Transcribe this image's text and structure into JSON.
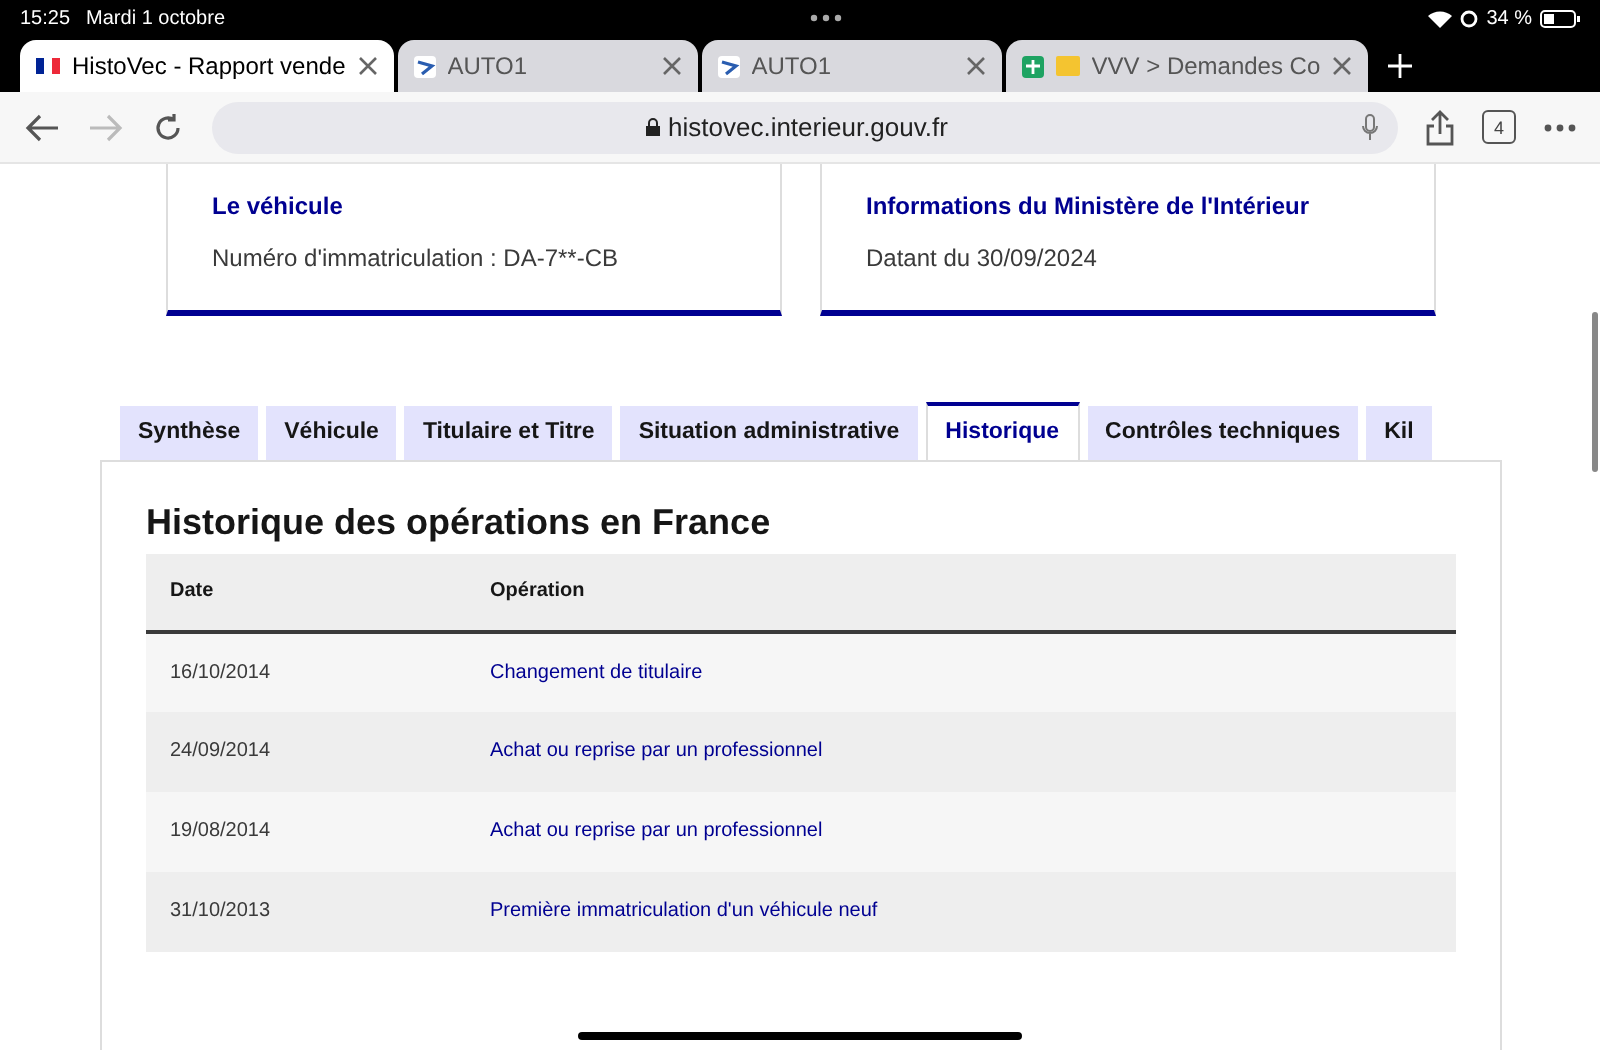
{
  "status_bar": {
    "time": "15:25",
    "date": "Mardi 1 octobre",
    "battery": "34 %"
  },
  "browser_tabs": [
    {
      "title": "HistoVec - Rapport vende",
      "kind": "flag",
      "selected": true
    },
    {
      "title": "AUTO1",
      "kind": "arrow",
      "selected": false
    },
    {
      "title": "AUTO1",
      "kind": "arrow",
      "selected": false
    },
    {
      "title": "VVV > Demandes Co",
      "kind": "sheet",
      "selected": false
    }
  ],
  "address_bar": {
    "url": "histovec.interieur.gouv.fr",
    "tab_count": "4"
  },
  "cards": [
    {
      "title": "Le véhicule",
      "text": "Numéro d'immatriculation : DA-7**-CB"
    },
    {
      "title": "Informations du Ministère de l'Intérieur",
      "text": "Datant du 30/09/2024"
    }
  ],
  "page_tabs": [
    {
      "label": "Synthèse",
      "selected": false
    },
    {
      "label": "Véhicule",
      "selected": false
    },
    {
      "label": "Titulaire et Titre",
      "selected": false
    },
    {
      "label": "Situation administrative",
      "selected": false
    },
    {
      "label": "Historique",
      "selected": true
    },
    {
      "label": "Contrôles techniques",
      "selected": false
    },
    {
      "label": "Kil",
      "selected": false
    }
  ],
  "section_title": "Historique des opérations en France",
  "table": {
    "columns": [
      "Date",
      "Opération"
    ],
    "rows": [
      {
        "date": "16/10/2014",
        "operation": "Changement de titulaire"
      },
      {
        "date": "24/09/2014",
        "operation": "Achat ou reprise par un professionnel"
      },
      {
        "date": "19/08/2014",
        "operation": "Achat ou reprise par un professionnel"
      },
      {
        "date": "31/10/2013",
        "operation": "Première immatriculation d'un véhicule neuf"
      }
    ]
  }
}
